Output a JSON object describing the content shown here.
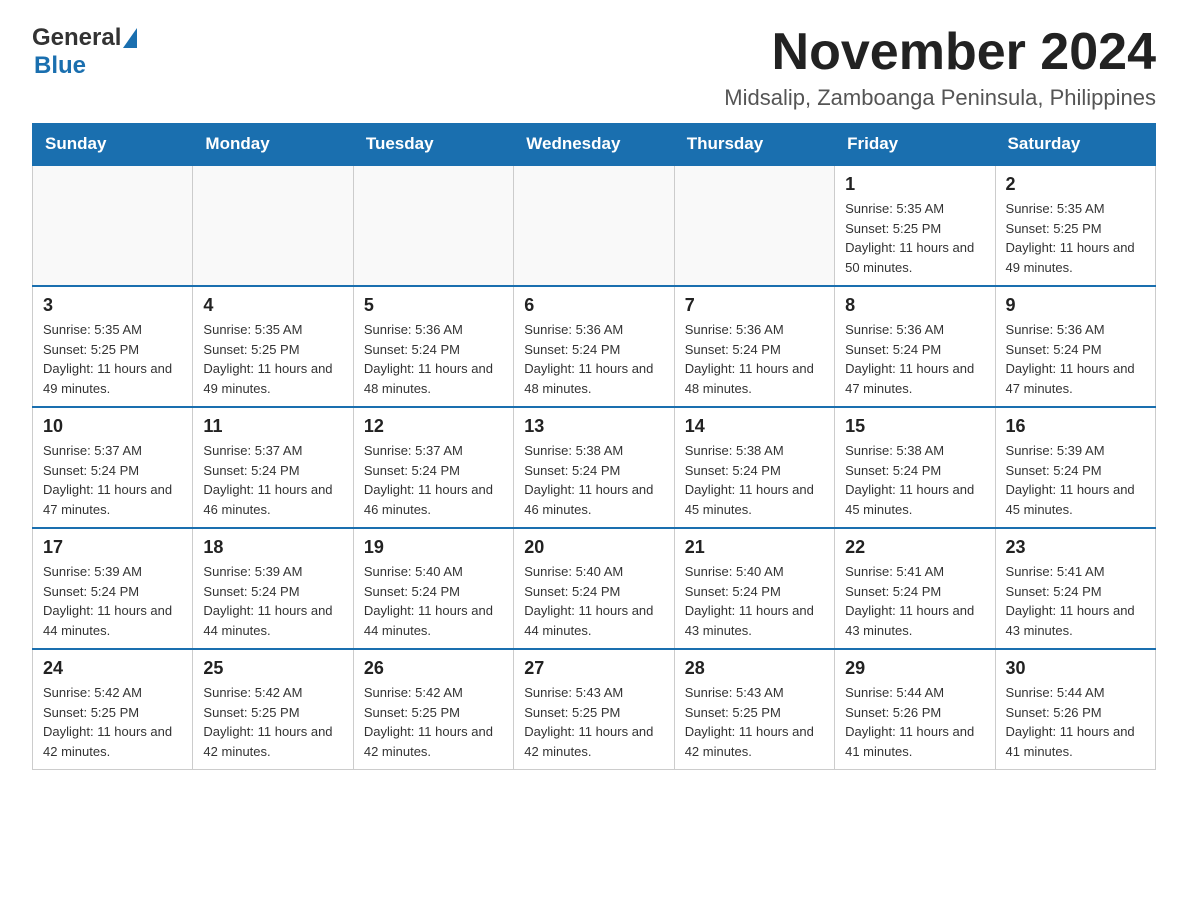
{
  "logo": {
    "general": "General",
    "blue": "Blue"
  },
  "title": "November 2024",
  "location": "Midsalip, Zamboanga Peninsula, Philippines",
  "days_of_week": [
    "Sunday",
    "Monday",
    "Tuesday",
    "Wednesday",
    "Thursday",
    "Friday",
    "Saturday"
  ],
  "weeks": [
    {
      "days": [
        {
          "number": "",
          "info": ""
        },
        {
          "number": "",
          "info": ""
        },
        {
          "number": "",
          "info": ""
        },
        {
          "number": "",
          "info": ""
        },
        {
          "number": "",
          "info": ""
        },
        {
          "number": "1",
          "info": "Sunrise: 5:35 AM\nSunset: 5:25 PM\nDaylight: 11 hours and 50 minutes."
        },
        {
          "number": "2",
          "info": "Sunrise: 5:35 AM\nSunset: 5:25 PM\nDaylight: 11 hours and 49 minutes."
        }
      ]
    },
    {
      "days": [
        {
          "number": "3",
          "info": "Sunrise: 5:35 AM\nSunset: 5:25 PM\nDaylight: 11 hours and 49 minutes."
        },
        {
          "number": "4",
          "info": "Sunrise: 5:35 AM\nSunset: 5:25 PM\nDaylight: 11 hours and 49 minutes."
        },
        {
          "number": "5",
          "info": "Sunrise: 5:36 AM\nSunset: 5:24 PM\nDaylight: 11 hours and 48 minutes."
        },
        {
          "number": "6",
          "info": "Sunrise: 5:36 AM\nSunset: 5:24 PM\nDaylight: 11 hours and 48 minutes."
        },
        {
          "number": "7",
          "info": "Sunrise: 5:36 AM\nSunset: 5:24 PM\nDaylight: 11 hours and 48 minutes."
        },
        {
          "number": "8",
          "info": "Sunrise: 5:36 AM\nSunset: 5:24 PM\nDaylight: 11 hours and 47 minutes."
        },
        {
          "number": "9",
          "info": "Sunrise: 5:36 AM\nSunset: 5:24 PM\nDaylight: 11 hours and 47 minutes."
        }
      ]
    },
    {
      "days": [
        {
          "number": "10",
          "info": "Sunrise: 5:37 AM\nSunset: 5:24 PM\nDaylight: 11 hours and 47 minutes."
        },
        {
          "number": "11",
          "info": "Sunrise: 5:37 AM\nSunset: 5:24 PM\nDaylight: 11 hours and 46 minutes."
        },
        {
          "number": "12",
          "info": "Sunrise: 5:37 AM\nSunset: 5:24 PM\nDaylight: 11 hours and 46 minutes."
        },
        {
          "number": "13",
          "info": "Sunrise: 5:38 AM\nSunset: 5:24 PM\nDaylight: 11 hours and 46 minutes."
        },
        {
          "number": "14",
          "info": "Sunrise: 5:38 AM\nSunset: 5:24 PM\nDaylight: 11 hours and 45 minutes."
        },
        {
          "number": "15",
          "info": "Sunrise: 5:38 AM\nSunset: 5:24 PM\nDaylight: 11 hours and 45 minutes."
        },
        {
          "number": "16",
          "info": "Sunrise: 5:39 AM\nSunset: 5:24 PM\nDaylight: 11 hours and 45 minutes."
        }
      ]
    },
    {
      "days": [
        {
          "number": "17",
          "info": "Sunrise: 5:39 AM\nSunset: 5:24 PM\nDaylight: 11 hours and 44 minutes."
        },
        {
          "number": "18",
          "info": "Sunrise: 5:39 AM\nSunset: 5:24 PM\nDaylight: 11 hours and 44 minutes."
        },
        {
          "number": "19",
          "info": "Sunrise: 5:40 AM\nSunset: 5:24 PM\nDaylight: 11 hours and 44 minutes."
        },
        {
          "number": "20",
          "info": "Sunrise: 5:40 AM\nSunset: 5:24 PM\nDaylight: 11 hours and 44 minutes."
        },
        {
          "number": "21",
          "info": "Sunrise: 5:40 AM\nSunset: 5:24 PM\nDaylight: 11 hours and 43 minutes."
        },
        {
          "number": "22",
          "info": "Sunrise: 5:41 AM\nSunset: 5:24 PM\nDaylight: 11 hours and 43 minutes."
        },
        {
          "number": "23",
          "info": "Sunrise: 5:41 AM\nSunset: 5:24 PM\nDaylight: 11 hours and 43 minutes."
        }
      ]
    },
    {
      "days": [
        {
          "number": "24",
          "info": "Sunrise: 5:42 AM\nSunset: 5:25 PM\nDaylight: 11 hours and 42 minutes."
        },
        {
          "number": "25",
          "info": "Sunrise: 5:42 AM\nSunset: 5:25 PM\nDaylight: 11 hours and 42 minutes."
        },
        {
          "number": "26",
          "info": "Sunrise: 5:42 AM\nSunset: 5:25 PM\nDaylight: 11 hours and 42 minutes."
        },
        {
          "number": "27",
          "info": "Sunrise: 5:43 AM\nSunset: 5:25 PM\nDaylight: 11 hours and 42 minutes."
        },
        {
          "number": "28",
          "info": "Sunrise: 5:43 AM\nSunset: 5:25 PM\nDaylight: 11 hours and 42 minutes."
        },
        {
          "number": "29",
          "info": "Sunrise: 5:44 AM\nSunset: 5:26 PM\nDaylight: 11 hours and 41 minutes."
        },
        {
          "number": "30",
          "info": "Sunrise: 5:44 AM\nSunset: 5:26 PM\nDaylight: 11 hours and 41 minutes."
        }
      ]
    }
  ]
}
